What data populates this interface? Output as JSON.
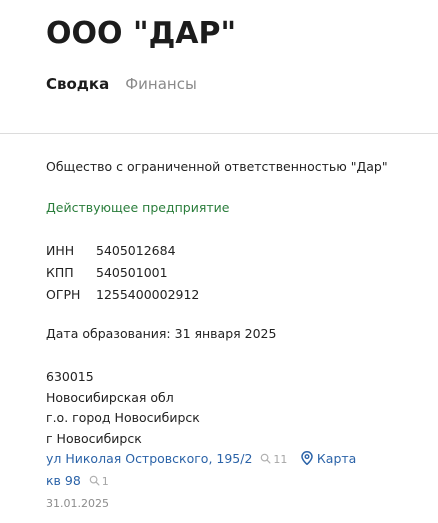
{
  "company": {
    "title": "ООО \"ДАР\""
  },
  "tabs": [
    {
      "label": "Сводка",
      "active": true
    },
    {
      "label": "Финансы",
      "active": false
    }
  ],
  "summary": {
    "full_name": "Общество с ограниченной ответственностью \"Дар\"",
    "status": "Действующее предприятие",
    "status_color": "#2a7d3b",
    "codes": [
      {
        "label": "ИНН",
        "value": "5405012684"
      },
      {
        "label": "КПП",
        "value": "540501001"
      },
      {
        "label": "ОГРН",
        "value": "1255400002912"
      }
    ],
    "registration_date": "Дата образования: 31 января 2025"
  },
  "address": {
    "postal_code": "630015",
    "region": "Новосибирская обл",
    "district": "г.о. город Новосибирск",
    "city": "г Новосибирск",
    "street": {
      "label": "ул Николая Островского, 195/2",
      "search_count": "11"
    },
    "office": {
      "label": "кв 98",
      "search_count": "1"
    },
    "map_label": "Карта",
    "date": "31.01.2025",
    "link_color": "#2b63a8"
  }
}
